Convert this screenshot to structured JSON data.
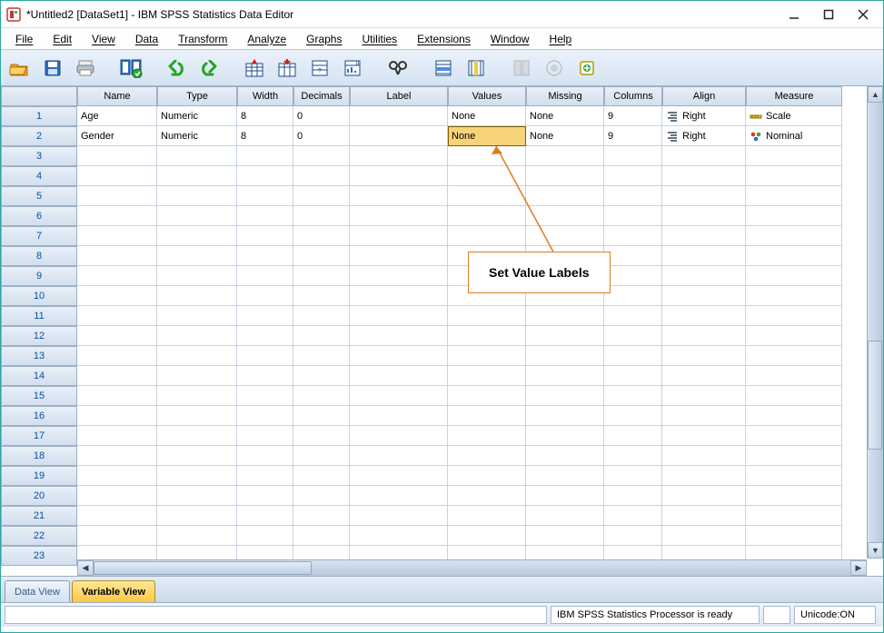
{
  "window": {
    "title": "*Untitled2 [DataSet1] - IBM SPSS Statistics Data Editor"
  },
  "menu": {
    "file": "File",
    "edit": "Edit",
    "view": "View",
    "data": "Data",
    "transform": "Transform",
    "analyze": "Analyze",
    "graphs": "Graphs",
    "utilities": "Utilities",
    "extensions": "Extensions",
    "window": "Window",
    "help": "Help"
  },
  "columns": {
    "name": "Name",
    "type": "Type",
    "width": "Width",
    "decimals": "Decimals",
    "label": "Label",
    "values": "Values",
    "missing": "Missing",
    "columns": "Columns",
    "align": "Align",
    "measure": "Measure"
  },
  "rows": [
    {
      "num": "1",
      "name": "Age",
      "type": "Numeric",
      "width": "8",
      "decimals": "0",
      "label": "",
      "values": "None",
      "missing": "None",
      "columns": "9",
      "align": "Right",
      "measure": "Scale"
    },
    {
      "num": "2",
      "name": "Gender",
      "type": "Numeric",
      "width": "8",
      "decimals": "0",
      "label": "",
      "values": "None",
      "missing": "None",
      "columns": "9",
      "align": "Right",
      "measure": "Nominal"
    }
  ],
  "empty_rows": [
    "3",
    "4",
    "5",
    "6",
    "7",
    "8",
    "9",
    "10",
    "11",
    "12",
    "13",
    "14",
    "15",
    "16",
    "17",
    "18",
    "19",
    "20",
    "21",
    "22",
    "23"
  ],
  "tabs": {
    "data_view": "Data View",
    "variable_view": "Variable View"
  },
  "status": {
    "processor": "IBM SPSS Statistics Processor is ready",
    "unicode": "Unicode:ON"
  },
  "annotation": {
    "text": "Set Value Labels"
  },
  "selected_cell": {
    "row_index": 1,
    "col_key": "values"
  }
}
